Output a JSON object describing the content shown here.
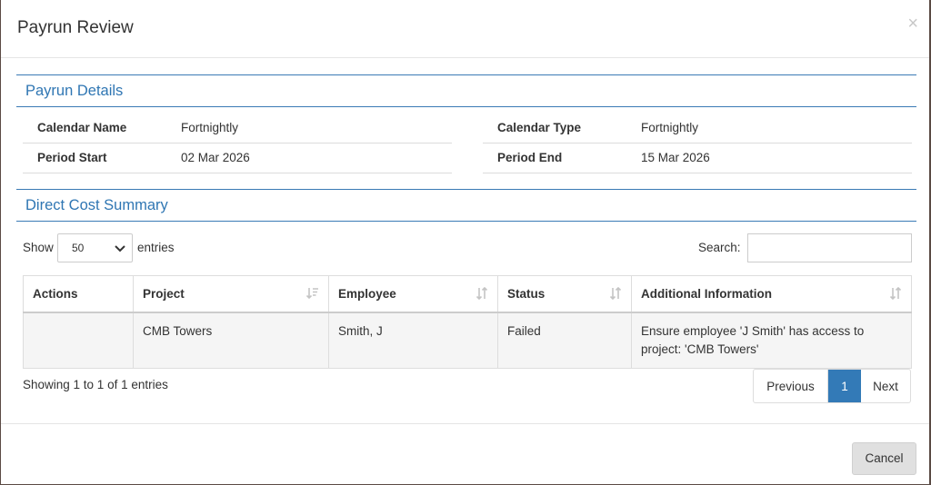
{
  "modal": {
    "title": "Payrun Review",
    "close_label": "×"
  },
  "payrun_details": {
    "heading": "Payrun Details",
    "calendar_name_label": "Calendar Name",
    "calendar_name_value": "Fortnightly",
    "calendar_type_label": "Calendar Type",
    "calendar_type_value": "Fortnightly",
    "period_start_label": "Period Start",
    "period_start_value": "02 Mar 2026",
    "period_end_label": "Period End",
    "period_end_value": "15 Mar 2026"
  },
  "direct_cost_summary": {
    "heading": "Direct Cost Summary",
    "show_label": "Show",
    "page_length": "50",
    "entries_label": "entries",
    "search_label": "Search:",
    "search_value": "",
    "columns": [
      "Actions",
      "Project",
      "Employee",
      "Status",
      "Additional Information"
    ],
    "rows": [
      {
        "actions": "",
        "project": "CMB Towers",
        "employee": "Smith, J",
        "status": "Failed",
        "info": "Ensure employee 'J Smith' has access to project: 'CMB Towers'"
      }
    ],
    "info_text": "Showing 1 to 1 of 1 entries",
    "pager": {
      "previous": "Previous",
      "current": "1",
      "next": "Next"
    }
  },
  "footer": {
    "cancel_label": "Cancel"
  },
  "colors": {
    "accent": "#337ab7",
    "section_title": "#2f76b3"
  }
}
